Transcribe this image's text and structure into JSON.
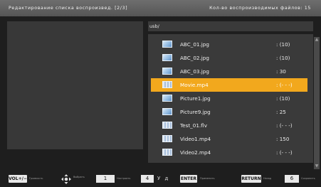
{
  "header": {
    "title": "Редактирование списка воспроизвед. [2/3]",
    "file_count": "Кол-во воспроизводимых файлов: 15"
  },
  "path": "usb/",
  "files": [
    {
      "name": "ABC_01.jpg",
      "count": ": (10)",
      "type": "image"
    },
    {
      "name": "ABC_02.jpg",
      "count": ": (10)",
      "type": "image"
    },
    {
      "name": "ABC_03.jpg",
      "count": ": 30",
      "type": "image"
    },
    {
      "name": "Movie.mp4",
      "count": ": (- - -)",
      "type": "video",
      "selected": true
    },
    {
      "name": "Picture1.jpg",
      "count": ": (10)",
      "type": "image"
    },
    {
      "name": "Picture9.jpg",
      "count": ": 25",
      "type": "image"
    },
    {
      "name": "Test_01.flv",
      "count": ": (- - -)",
      "type": "video"
    },
    {
      "name": "Video1.mp4",
      "count": ": 150",
      "type": "video"
    },
    {
      "name": "Video2.mp4",
      "count": ": (- - -)",
      "type": "video"
    }
  ],
  "footer": {
    "vol_key": "VOL+/−",
    "vol_label": "Громкость",
    "dpad_label": "Выбрать",
    "key1": "1",
    "key1_label": "Настроить",
    "key4": "4",
    "key4_label": "У д",
    "enter_key": "ENTER",
    "enter_label": "Применить",
    "return_key": "RETURN",
    "return_label": "Назад",
    "key6": "6",
    "key6_label": "Сохранить"
  },
  "colors": {
    "selection": "#f2a81d",
    "header_bg": "#606060",
    "panel_bg": "#3a3a3a"
  }
}
